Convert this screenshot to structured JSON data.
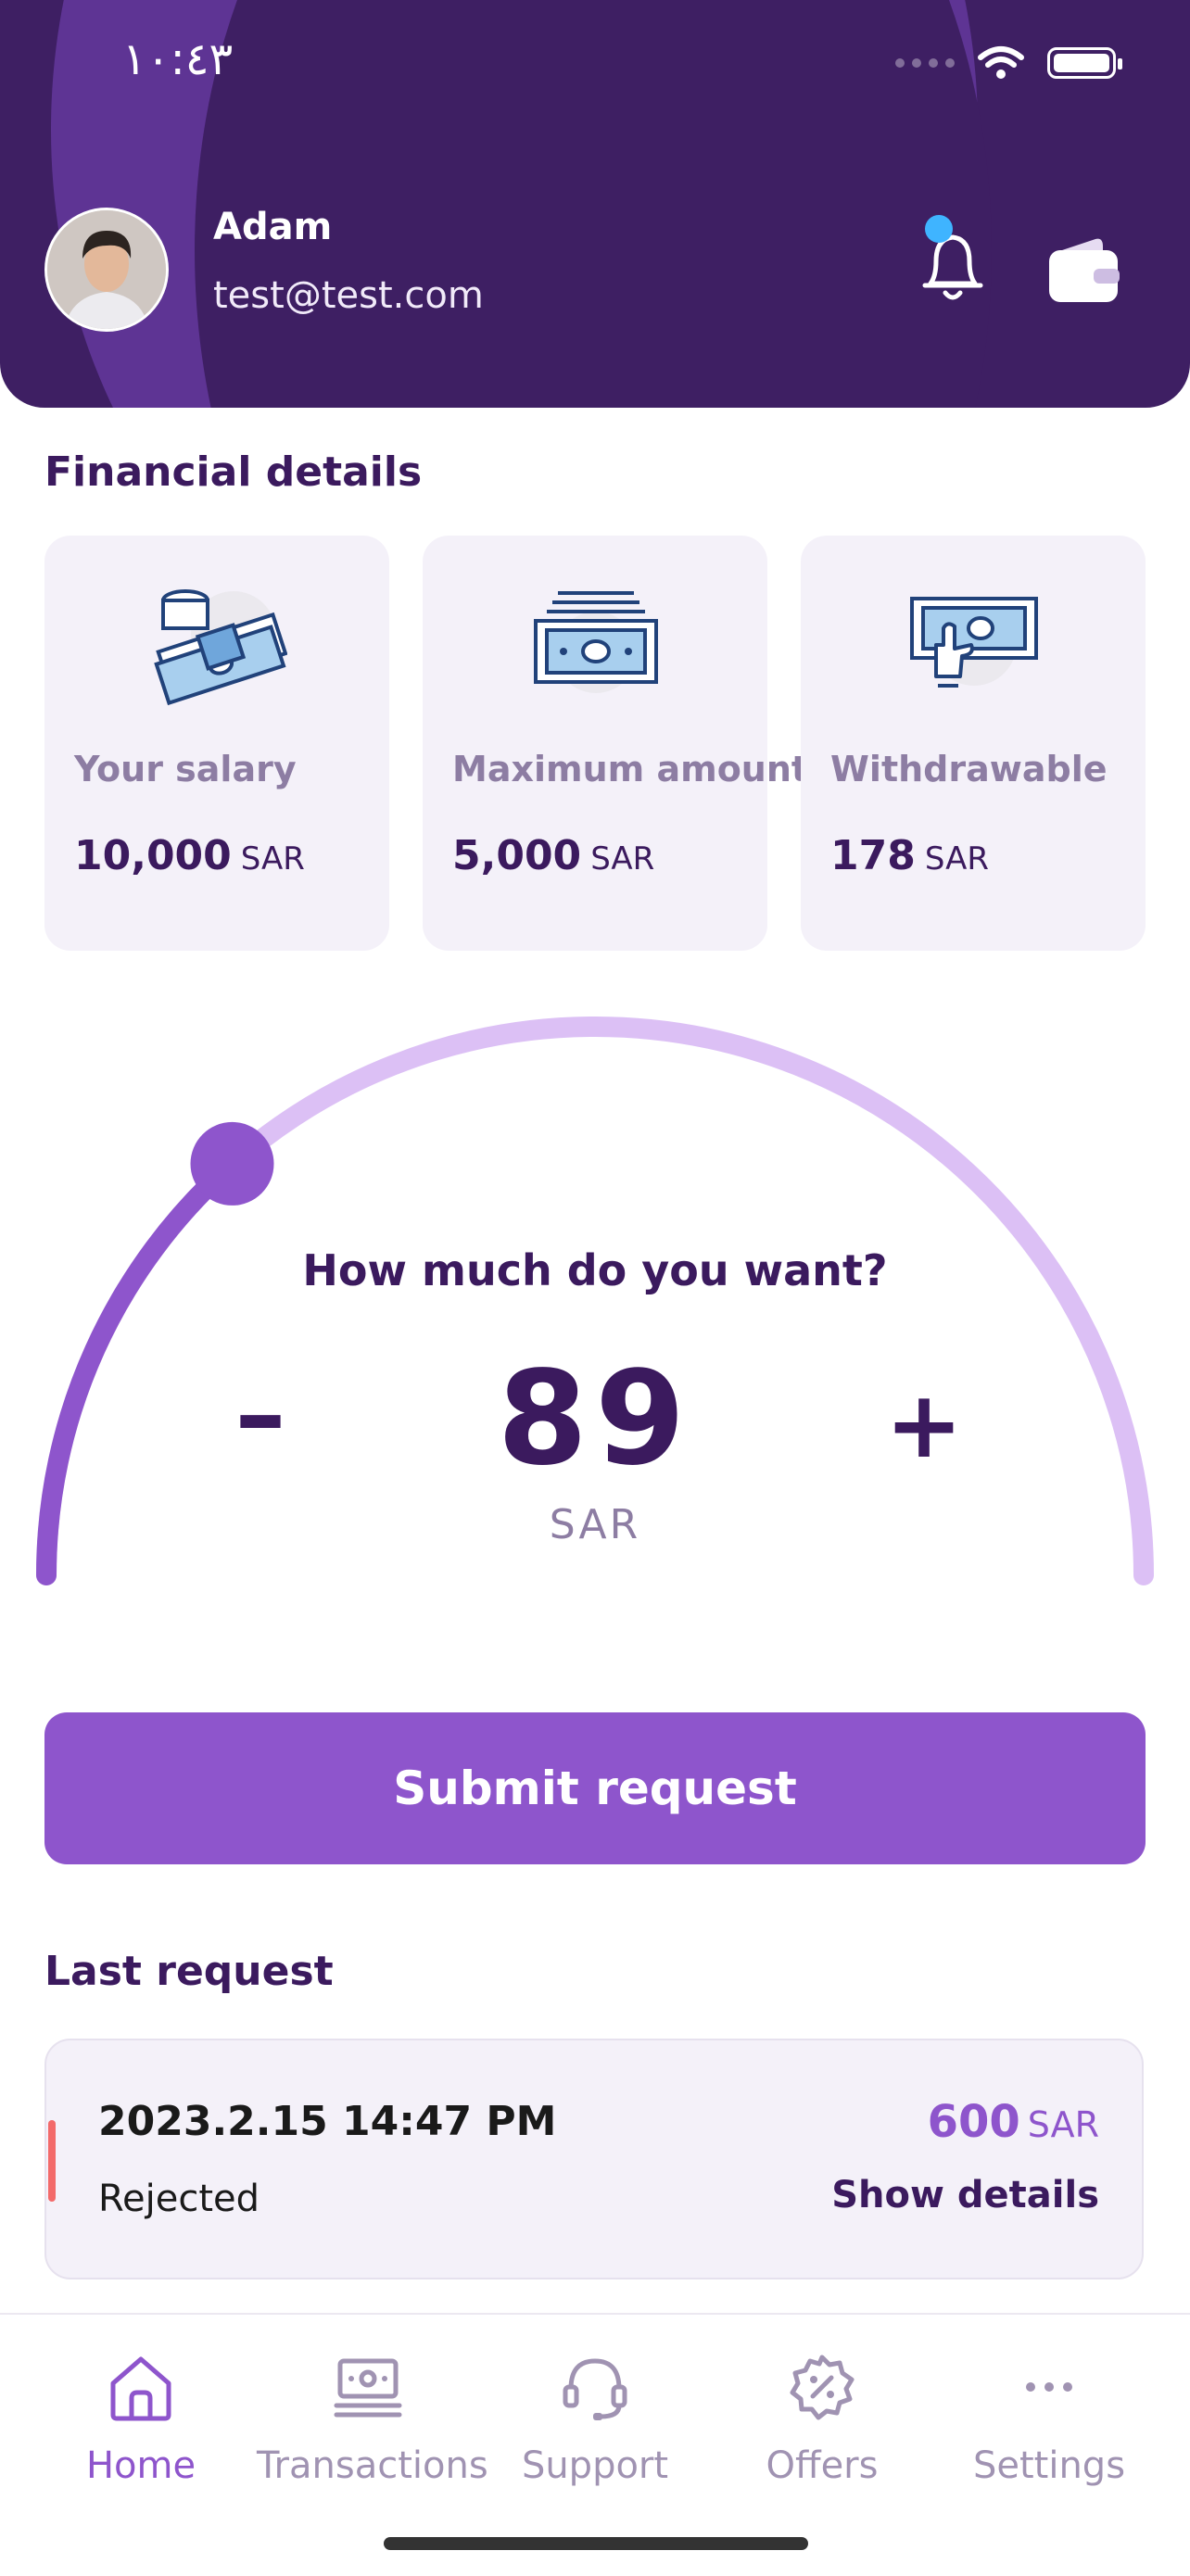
{
  "status_bar": {
    "time": "١٠:٤٣"
  },
  "header": {
    "user_name": "Adam",
    "user_email": "test@test.com",
    "notification_badge": true
  },
  "financial": {
    "title": "Financial details",
    "cards": [
      {
        "label": "Your salary",
        "amount": "10,000",
        "unit": "SAR",
        "icon": "money-stack-icon"
      },
      {
        "label": "Maximum amount",
        "amount": "5,000",
        "unit": "SAR",
        "icon": "banknote-stack-icon"
      },
      {
        "label": "Withdrawable",
        "amount": "178",
        "unit": "SAR",
        "icon": "hand-cash-icon"
      }
    ]
  },
  "request_picker": {
    "question": "How much do you want?",
    "minus_label": "–",
    "plus_label": "+",
    "amount": "89",
    "unit": "SAR",
    "slider_fraction": 0.27
  },
  "submit_label": "Submit request",
  "last_request": {
    "title": "Last request",
    "datetime": "2023.2.15  14:47 PM",
    "status": "Rejected",
    "amount": "600",
    "unit": "SAR",
    "details_label": "Show details"
  },
  "tabs": [
    {
      "label": "Home",
      "icon": "home-icon",
      "active": true
    },
    {
      "label": "Transactions",
      "icon": "transactions-icon",
      "active": false
    },
    {
      "label": "Support",
      "icon": "headset-icon",
      "active": false
    },
    {
      "label": "Offers",
      "icon": "discount-badge-icon",
      "active": false
    },
    {
      "label": "Settings",
      "icon": "more-icon",
      "active": false
    }
  ],
  "colors": {
    "header_bg": "#3e1f63",
    "accent": "#8e55cc",
    "accent_light": "#dcc0f5",
    "text_dark": "#3b1a5e",
    "muted": "#8d7da3",
    "rejected": "#f36a6a",
    "card_bg": "#f4f1f9"
  }
}
